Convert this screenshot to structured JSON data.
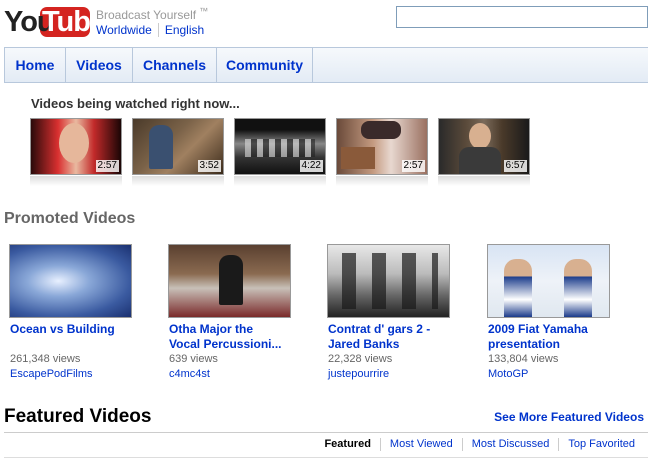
{
  "header": {
    "logo_text": "YouTube",
    "tagline": "Broadcast Yourself",
    "trademark": "™",
    "locale_region": "Worldwide",
    "locale_language": "English"
  },
  "nav": {
    "tabs": [
      {
        "label": "Home"
      },
      {
        "label": "Videos"
      },
      {
        "label": "Channels"
      },
      {
        "label": "Community"
      }
    ],
    "search_value": ""
  },
  "watched_now": {
    "title": "Videos being watched right now...",
    "videos": [
      {
        "duration": "2:57",
        "thumb": "woman-red-background"
      },
      {
        "duration": "3:52",
        "thumb": "man-in-room"
      },
      {
        "duration": "4:22",
        "thumb": "black-white-group"
      },
      {
        "duration": "2:57",
        "thumb": "guitar-player-collage"
      },
      {
        "duration": "6:57",
        "thumb": "man-in-suit"
      }
    ]
  },
  "promoted": {
    "title": "Promoted Videos",
    "videos": [
      {
        "title_line1": "Ocean vs Building",
        "title_line2": "",
        "views": "261,348 views",
        "user": "EscapePodFilms",
        "thumb": "blue-water-texture"
      },
      {
        "title_line1": "Otha Major the",
        "title_line2": "Vocal Percussioni...",
        "views": "639 views",
        "user": "c4mc4st",
        "thumb": "man-on-bed"
      },
      {
        "title_line1": "Contrat d' gars 2 -",
        "title_line2": "Jared Banks",
        "views": "22,328 views",
        "user": "justepourrire",
        "thumb": "black-white-dancers"
      },
      {
        "title_line1": "2009 Fiat Yamaha",
        "title_line2": "presentation",
        "views": "133,804 views",
        "user": "MotoGP",
        "thumb": "two-riders-press"
      }
    ]
  },
  "featured": {
    "title": "Featured Videos",
    "see_more": "See More Featured Videos",
    "tabs": [
      {
        "label": "Featured",
        "active": true
      },
      {
        "label": "Most Viewed",
        "active": false
      },
      {
        "label": "Most Discussed",
        "active": false
      },
      {
        "label": "Top Favorited",
        "active": false
      }
    ]
  }
}
